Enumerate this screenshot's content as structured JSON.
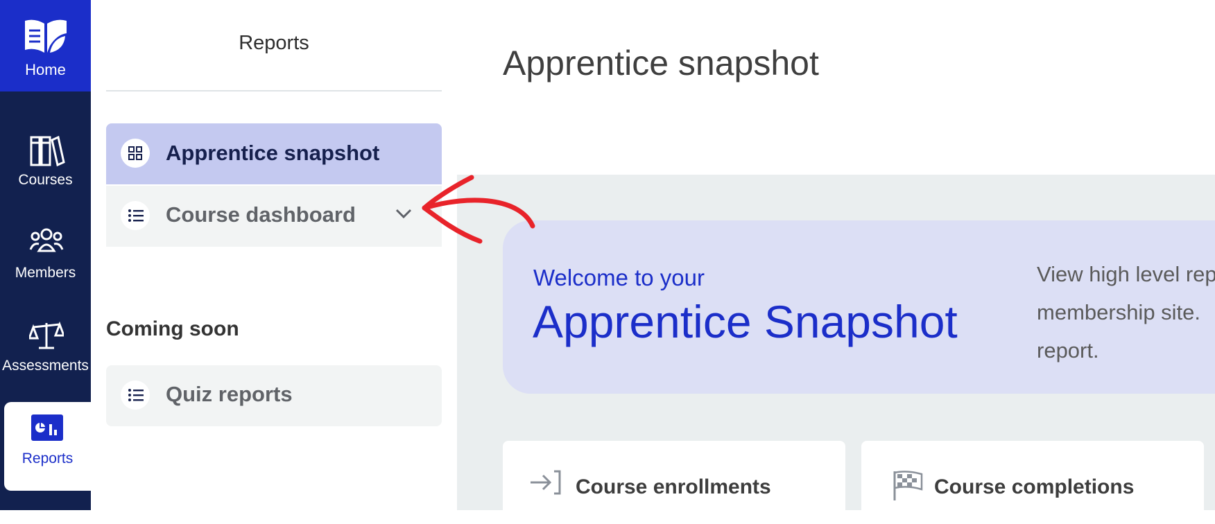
{
  "rail": {
    "home_label": "Home",
    "items": [
      {
        "label": "Courses",
        "icon": "books-icon"
      },
      {
        "label": "Members",
        "icon": "members-icon"
      },
      {
        "label": "Assessments",
        "icon": "scales-icon"
      },
      {
        "label": "Reports",
        "icon": "reports-icon"
      }
    ],
    "active": "Reports"
  },
  "sidebar": {
    "title": "Reports",
    "items": [
      {
        "label": "Apprentice snapshot",
        "icon": "grid-icon",
        "active": true
      },
      {
        "label": "Course dashboard",
        "icon": "list-icon",
        "expandable": true
      }
    ],
    "coming_soon_heading": "Coming soon",
    "coming_soon_items": [
      {
        "label": "Quiz reports",
        "icon": "list-icon"
      }
    ]
  },
  "main": {
    "title": "Apprentice snapshot",
    "welcome": {
      "small": "Welcome to your",
      "big": "Apprentice Snapshot",
      "desc_lines": [
        "View high level rep",
        "membership site.",
        "report."
      ]
    },
    "cards": [
      {
        "label": "Course enrollments",
        "icon": "enroll-icon"
      },
      {
        "label": "Course completions",
        "icon": "checkered-flag-icon"
      }
    ]
  },
  "colors": {
    "rail_bg": "#12214f",
    "accent": "#1b2ec9",
    "active_nav_bg": "#c4c9f0",
    "annotation_arrow": "#e8232a"
  }
}
